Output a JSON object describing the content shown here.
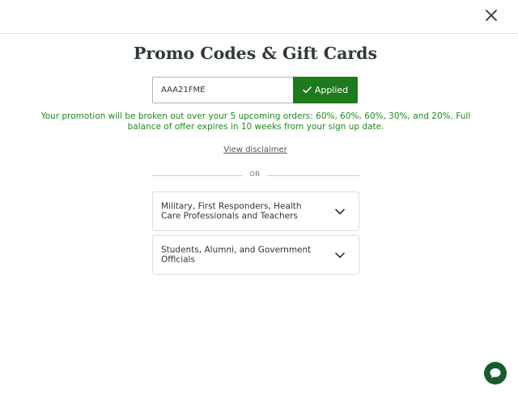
{
  "modal": {
    "title": "Promo Codes & Gift Cards"
  },
  "promo": {
    "code_value": "AAA21FME",
    "applied_label": "Applied",
    "message": "Your promotion will be broken out over your 5 upcoming orders: 60%, 60%, 60%, 30%, and 20%. Full balance of offer expires in 10 weeks from your sign up date.",
    "disclaimer_link": "View disclaimer"
  },
  "divider": {
    "text": "OR"
  },
  "discount_options": [
    {
      "label": "Military, First Responders, Health Care Professionals and Teachers"
    },
    {
      "label": "Students, Alumni, and Government Officials"
    }
  ],
  "icons": {
    "close": "close-icon",
    "applied_check": "checkmark-icon",
    "expand": "chevron-down-icon",
    "chat": "chat-bubble-icon"
  },
  "colors": {
    "primary_green": "#1d7a1d",
    "message_green": "#1f8a1f",
    "chat_green": "#1a5a2c",
    "title_color": "#2f3b34"
  }
}
